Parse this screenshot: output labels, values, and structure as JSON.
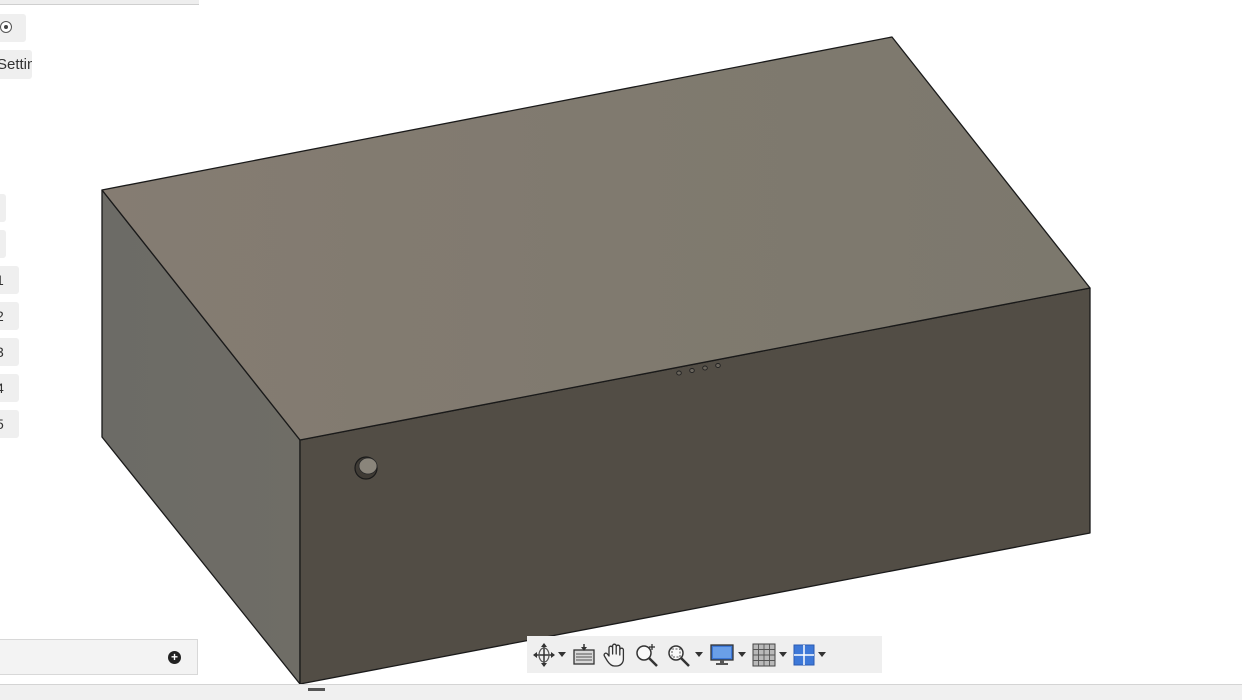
{
  "browser_panel": {
    "settings_label": "Settings",
    "origin_items": [
      "1",
      "2",
      "3",
      "4",
      "5"
    ]
  },
  "model": {
    "top_face_color": "#807a6f",
    "front_face_color": "#524d45",
    "side_face_color": "#6a6760",
    "edge_color": "#1a1a1a"
  },
  "nav_toolbar": {
    "tools": [
      {
        "name": "orbit-icon",
        "has_dropdown": true
      },
      {
        "name": "look-at-icon",
        "has_dropdown": false
      },
      {
        "name": "pan-icon",
        "has_dropdown": false
      },
      {
        "name": "zoom-icon",
        "has_dropdown": false
      },
      {
        "name": "zoom-window-icon",
        "has_dropdown": true
      },
      {
        "name": "display-settings-icon",
        "has_dropdown": true
      },
      {
        "name": "grid-snaps-icon",
        "has_dropdown": true
      },
      {
        "name": "viewports-icon",
        "has_dropdown": true
      }
    ]
  },
  "accent": {
    "viewport_blue": "#3d78d8"
  }
}
